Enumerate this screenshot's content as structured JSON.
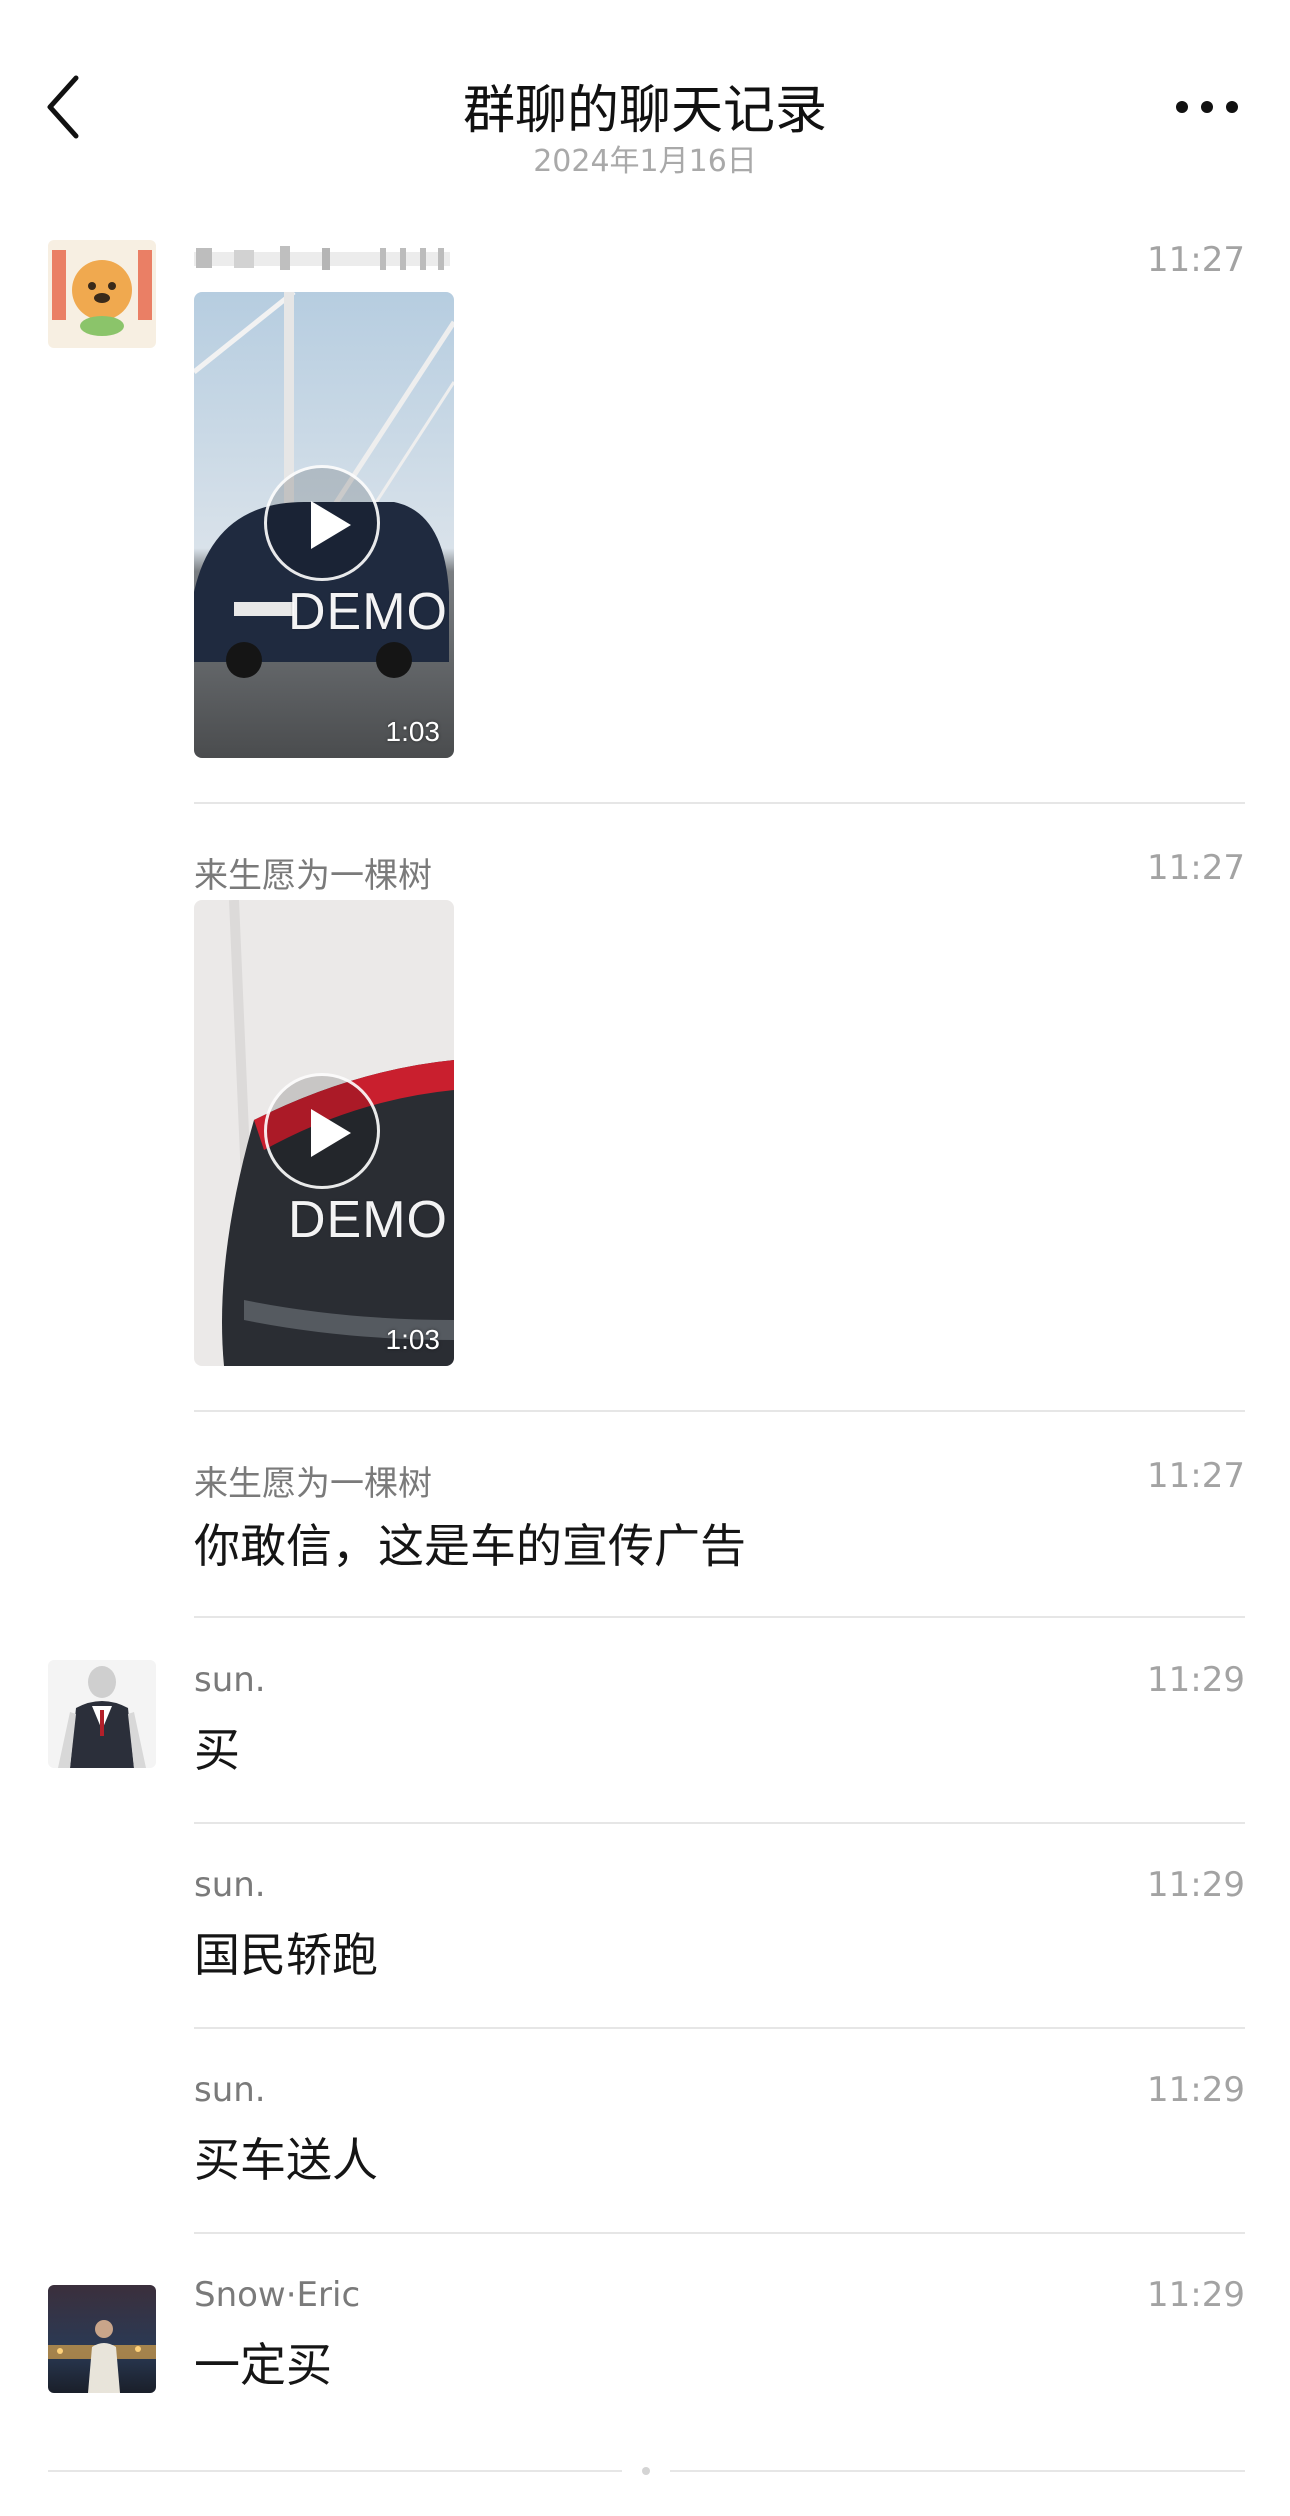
{
  "header": {
    "title": "群聊的聊天记录",
    "date": "2024年1月16日"
  },
  "messages": [
    {
      "sender": "",
      "time": "11:27",
      "type": "video",
      "duration": "1:03",
      "watermark": "DEMO"
    },
    {
      "sender": "来生愿为一棵树",
      "time": "11:27",
      "type": "video",
      "duration": "1:03",
      "watermark": "DEMO"
    },
    {
      "sender": "来生愿为一棵树",
      "time": "11:27",
      "type": "text",
      "text": "你敢信，这是车的宣传广告"
    },
    {
      "sender": "sun.",
      "time": "11:29",
      "type": "text",
      "text": "买"
    },
    {
      "sender": "sun.",
      "time": "11:29",
      "type": "text",
      "text": "国民轿跑"
    },
    {
      "sender": "sun.",
      "time": "11:29",
      "type": "text",
      "text": "买车送人"
    },
    {
      "sender": "Snow·Eric",
      "time": "11:29",
      "type": "text",
      "text": "一定买"
    }
  ],
  "icons": {
    "back": "chevron-left-icon",
    "more": "more-dots-icon",
    "play": "play-icon"
  },
  "colors": {
    "secondary_text": "#7a7a7a",
    "time_text": "#a3a3a3",
    "divider": "#e6e6e6"
  }
}
